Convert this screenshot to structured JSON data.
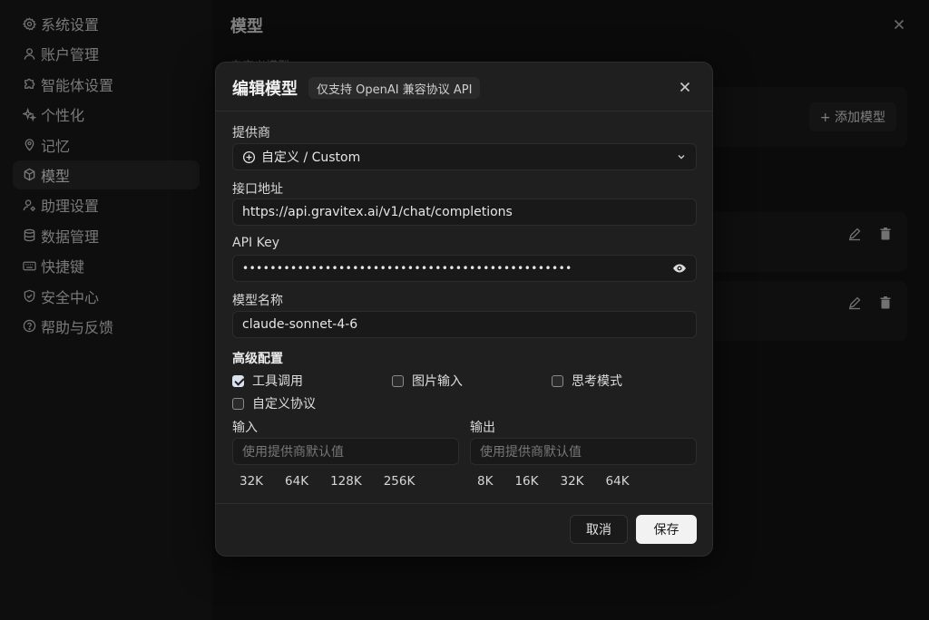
{
  "sidebar": {
    "items": [
      {
        "label": "系统设置",
        "icon": "gear-icon"
      },
      {
        "label": "账户管理",
        "icon": "user-icon"
      },
      {
        "label": "智能体设置",
        "icon": "puzzle-icon"
      },
      {
        "label": "个性化",
        "icon": "sparkle-icon"
      },
      {
        "label": "记忆",
        "icon": "location-pin-icon"
      },
      {
        "label": "模型",
        "icon": "cube-icon",
        "active": true
      },
      {
        "label": "助理设置",
        "icon": "user-gear-icon"
      },
      {
        "label": "数据管理",
        "icon": "database-icon"
      },
      {
        "label": "快捷键",
        "icon": "keyboard-icon"
      },
      {
        "label": "安全中心",
        "icon": "shield-icon"
      },
      {
        "label": "帮助与反馈",
        "icon": "help-icon"
      }
    ]
  },
  "main": {
    "title": "模型",
    "section_label": "自定义模型",
    "add_model_label": "+ 添加模型"
  },
  "modal": {
    "title": "编辑模型",
    "badge": "仅支持 OpenAI 兼容协议 API",
    "provider": {
      "label": "提供商",
      "value": "自定义 / Custom"
    },
    "endpoint": {
      "label": "接口地址",
      "value": "https://api.gravitex.ai/v1/chat/completions"
    },
    "api_key": {
      "label": "API Key",
      "value": "••••••••••••••••••••••••••••••••••••••••••••••••"
    },
    "model_name": {
      "label": "模型名称",
      "value": "claude-sonnet-4-6"
    },
    "advanced": {
      "label": "高级配置",
      "options": [
        {
          "label": "工具调用",
          "checked": true
        },
        {
          "label": "图片输入",
          "checked": false
        },
        {
          "label": "思考模式",
          "checked": false
        },
        {
          "label": "自定义协议",
          "checked": false
        }
      ]
    },
    "input": {
      "label": "输入",
      "placeholder": "使用提供商默认值",
      "presets": [
        "32K",
        "64K",
        "128K",
        "256K"
      ]
    },
    "output": {
      "label": "输出",
      "placeholder": "使用提供商默认值",
      "presets": [
        "8K",
        "16K",
        "32K",
        "64K"
      ]
    },
    "cancel_label": "取消",
    "save_label": "保存"
  },
  "colors": {
    "background": "#141414",
    "sidebar": "#1a1a1a",
    "modal": "#1f1f1f",
    "checkbox_checked": "#d9e2ee"
  }
}
